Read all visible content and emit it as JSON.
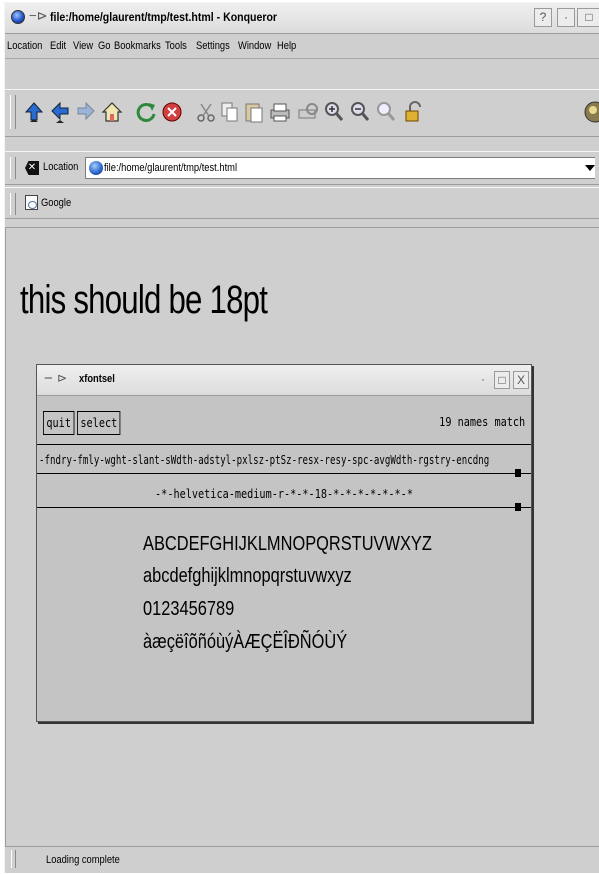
{
  "window": {
    "title": "file:/home/glaurent/tmp/test.html - Konqueror",
    "help_btn": "?",
    "minimize_btn": "·",
    "maximize_btn": "□",
    "close_btn": "X"
  },
  "menubar": [
    "Location",
    "Edit",
    "View",
    "Go",
    "Bookmarks",
    "Tools",
    "Settings",
    "Window",
    "Help"
  ],
  "toolbar": {
    "icons": [
      "up-arrow-icon",
      "back-arrow-icon",
      "forward-arrow-icon",
      "home-icon",
      "reload-icon",
      "stop-icon",
      "cut-icon",
      "copy-icon",
      "paste-icon",
      "print-icon",
      "print-preview-icon",
      "zoom-in-icon",
      "zoom-out-icon",
      "zoom-icon",
      "lock-icon",
      "throbber-icon"
    ]
  },
  "location_bar": {
    "label": "Location",
    "value": "file:/home/glaurent/tmp/test.html"
  },
  "bookmark_bar": {
    "items": [
      "Google"
    ]
  },
  "page": {
    "heading": "this should be 18pt"
  },
  "xfontsel": {
    "title": "xfontsel",
    "buttons": [
      "quit",
      "select"
    ],
    "match_count": "19 names match",
    "pattern": "-fndry-fmly-wght-slant-sWdth-adstyl-pxlsz-ptSz-resx-resy-spc-avgWdth-rgstry-encdng",
    "font_name": "-*-helvetica-medium-r-*-*-18-*-*-*-*-*-*-*",
    "samples": [
      "ABCDEFGHIJKLMNOPQRSTUVWXYZ",
      "abcdefghijklmnopqrstuvwxyz",
      "0123456789",
      "àæçëîõñóùýÀÆÇËÎÐÑÓÙÝ"
    ]
  },
  "status": "Loading complete"
}
